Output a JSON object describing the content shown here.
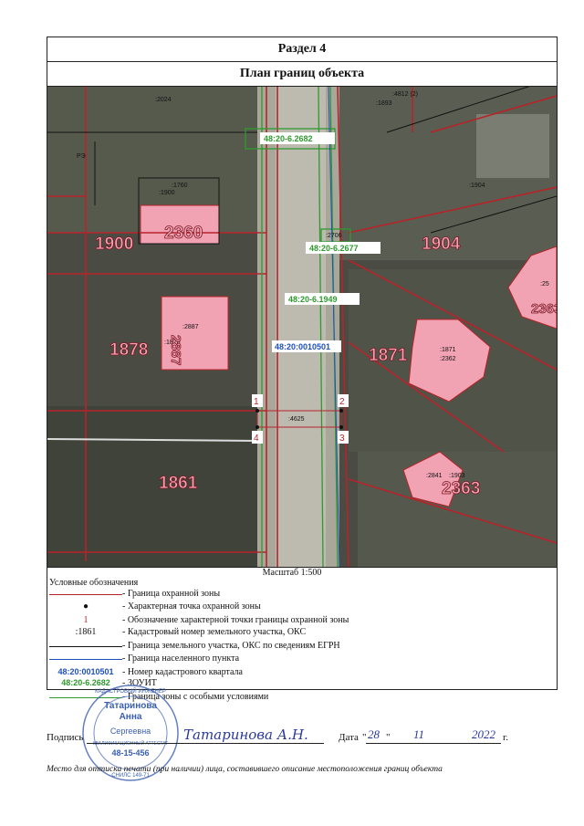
{
  "header": {
    "section": "Раздел 4",
    "title": "План границ объекта"
  },
  "map": {
    "parcels": [
      ":2024",
      ":4812 (2)",
      ":1893",
      ":1904",
      ":1900",
      ":1760",
      ":2887",
      ":1878",
      ":1871",
      ":2362",
      ":4625",
      ":2841",
      ":1903",
      ":2706",
      ":25"
    ],
    "big_labels": [
      "1900",
      "2360",
      "1904",
      "1878",
      "1871",
      "1861",
      "2363",
      "2363",
      "2887"
    ],
    "zone_labels": [
      "48:20-6.2682",
      "48:20-6.2677",
      "48:20-6.1949"
    ],
    "quarter_label": "48:20:0010501",
    "points": [
      "1",
      "2",
      "3",
      "4"
    ],
    "small": [
      "РЭ"
    ]
  },
  "scale": "Масштаб 1:500",
  "legend": {
    "title": "Условные обозначения",
    "items": [
      {
        "sym": "",
        "text": "- Граница охранной зоны"
      },
      {
        "sym": "●",
        "text": "- Характерная точка охранной зоны"
      },
      {
        "sym": "1",
        "text": "- Обозначение характерной точки границы охранной зоны"
      },
      {
        "sym": ":1861",
        "text": "- Кадастровый номер земельного участка, ОКС"
      },
      {
        "sym": "",
        "text": "- Граница земельного участка, ОКС по сведениям ЕГРН"
      },
      {
        "sym": "",
        "text": "- Граница населенного пункта"
      },
      {
        "sym": "48:20:0010501",
        "text": "- Номер кадастрового квартала"
      },
      {
        "sym": "48:20-6.2682",
        "text": "- ЗОУИТ"
      },
      {
        "sym": "",
        "text": "- Граница зоны с особыми условиями"
      }
    ]
  },
  "stamp": {
    "name1": "Татаринова",
    "name2": "Анна",
    "name3": "Сергеевна",
    "cert_label": "КВАЛИФИКАЦИОННЫЙ АТТЕСТАТ",
    "cert": "48-15-456",
    "ring_top": "КАДАСТРОВЫЙ ИНЖЕНЕР",
    "ring_bottom": "СНИЛС 149-71"
  },
  "signature": {
    "label": "Подпись",
    "handwritten": "Татаринова А.Н.",
    "date_label": "Дата",
    "day": "28",
    "month": "11",
    "year": "2022",
    "year_suffix": "г."
  },
  "note": "Место для оттиска печати (при наличии) лица, составившего описание местоположения границ объекта",
  "colors": {
    "zone_green": "#2e9a2e",
    "quarter_blue": "#1f4fbf",
    "parcel_red": "#b8232a",
    "building_pink": "#f2a3b3",
    "stamp_blue": "#3a5fb0"
  }
}
